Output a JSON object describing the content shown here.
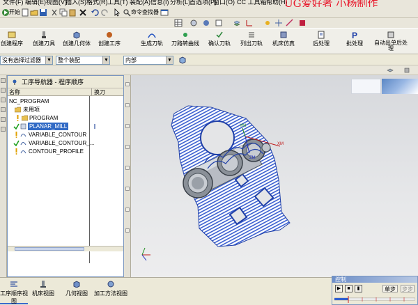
{
  "menubar": {
    "items": [
      "文件(F)",
      "编辑(E)",
      "视图(V)",
      "插入(S)",
      "格式(R)",
      "工具(T)",
      "装配(A)",
      "信息(I)",
      "分析(L)",
      "首选项(P)",
      "窗口(O)",
      "CC 工具箱",
      "帮助(H)"
    ],
    "watermark": "UG爱好者 小杨制作"
  },
  "toolbar1": {
    "start_label": "开始",
    "command_finder": "命令查找器"
  },
  "main_toolbar": {
    "buttons": [
      {
        "label": "创建程序",
        "icon": "create-program-icon"
      },
      {
        "label": "创建刀具",
        "icon": "create-tool-icon"
      },
      {
        "label": "创建几何体",
        "icon": "create-geometry-icon"
      },
      {
        "label": "创建工序",
        "icon": "create-operation-icon"
      },
      {
        "label": "生成刀轨",
        "icon": "generate-toolpath-icon"
      },
      {
        "label": "刀路转曲线",
        "icon": "path-to-curve-icon"
      },
      {
        "label": "确认刀轨",
        "icon": "verify-toolpath-icon"
      },
      {
        "label": "列出刀轨",
        "icon": "list-toolpath-icon"
      },
      {
        "label": "机床仿真",
        "icon": "machine-sim-icon"
      },
      {
        "label": "后处理",
        "icon": "postprocess-icon"
      },
      {
        "label": "批处理",
        "icon": "batch-icon"
      },
      {
        "label": "自动出单后处理",
        "icon": "auto-post-icon"
      }
    ]
  },
  "filterrow": {
    "filter": "没有选择过滤器",
    "assembly": "整个装配",
    "scope": "内部"
  },
  "navigator": {
    "title": "工序导航器 - 程序顺序",
    "columns": [
      "名称",
      "换刀"
    ],
    "rows": [
      {
        "name": "NC_PROGRAM",
        "indent": 0
      },
      {
        "name": "未用项",
        "indent": 1
      },
      {
        "name": "PROGRAM",
        "indent": 1
      },
      {
        "name": "PLANAR_MILL",
        "indent": 1
      },
      {
        "name": "VARIABLE_CONTOUR",
        "indent": 1
      },
      {
        "name": "VARIABLE_CONTOUR_...",
        "indent": 1
      },
      {
        "name": "CONTOUR_PROFILE",
        "indent": 1
      }
    ]
  },
  "axes": {
    "xm": "XM",
    "ym": "YM",
    "zm": "ZM"
  },
  "bottom_tabs": [
    "工序顺序视图",
    "机床视图",
    "几何视图",
    "加工方法视图"
  ],
  "control_panel": {
    "title": "控制",
    "single_step": "单步",
    "step_next": "步步"
  }
}
